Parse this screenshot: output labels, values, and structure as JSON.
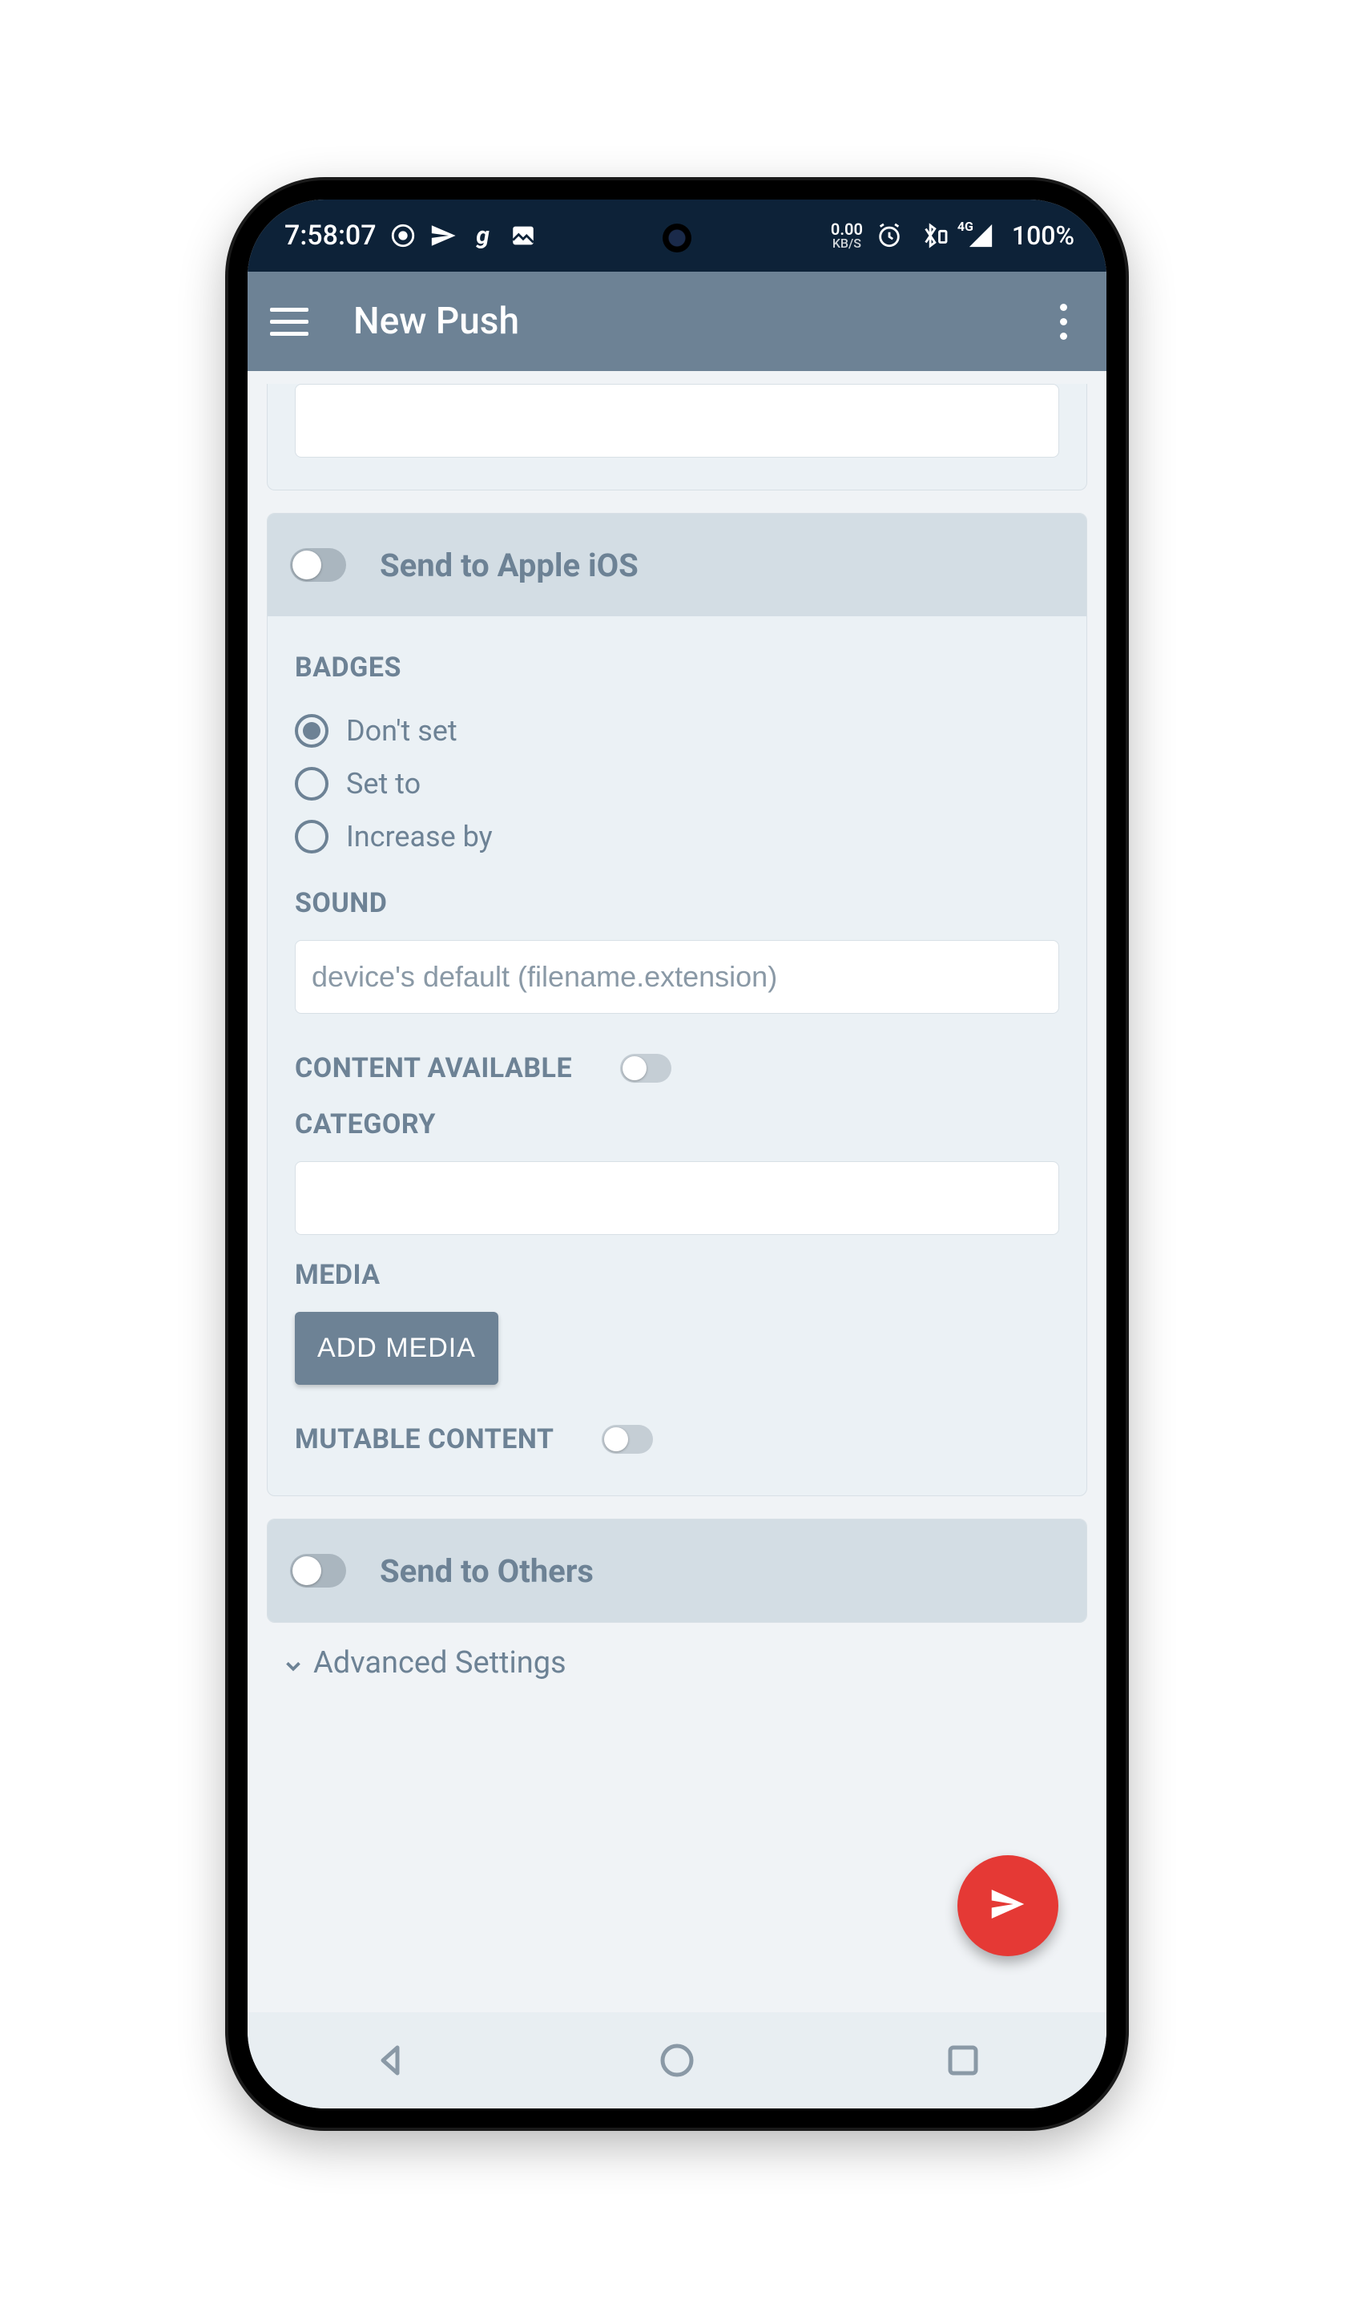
{
  "statusbar": {
    "time": "7:58:07",
    "speed_value": "0.00",
    "speed_unit": "KB/S",
    "network_badge": "4G",
    "battery_pct": "100%"
  },
  "toolbar": {
    "title": "New Push"
  },
  "ios_section": {
    "head_label": "Send to Apple iOS",
    "badges_label": "BADGES",
    "badges_options": [
      "Don't set",
      "Set to",
      "Increase by"
    ],
    "sound_label": "SOUND",
    "sound_placeholder": "device's default (filename.extension)",
    "content_available_label": "CONTENT AVAILABLE",
    "category_label": "CATEGORY",
    "media_label": "MEDIA",
    "add_media_label": "ADD MEDIA",
    "mutable_content_label": "MUTABLE CONTENT"
  },
  "others_section": {
    "head_label": "Send to Others"
  },
  "advanced_label": "Advanced Settings"
}
